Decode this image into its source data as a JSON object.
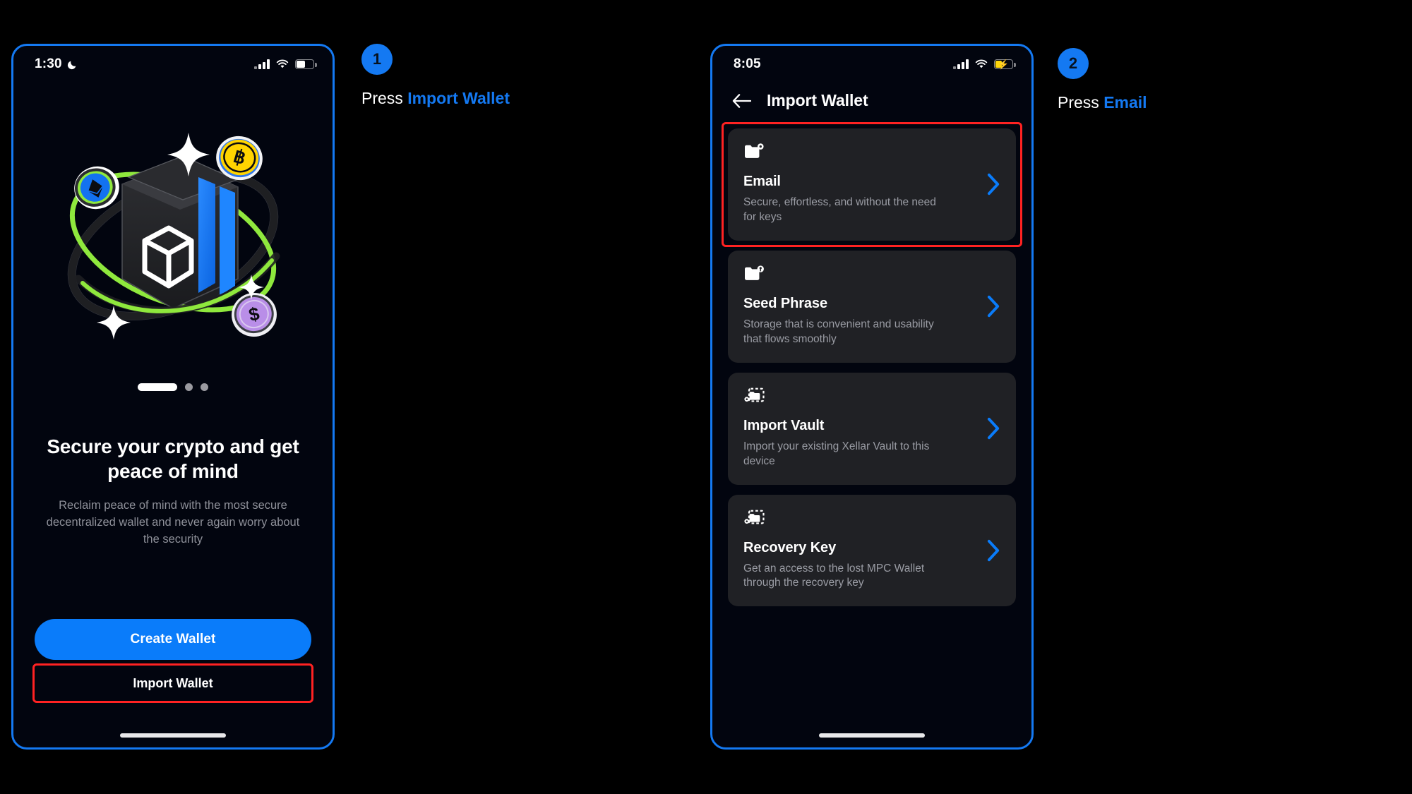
{
  "background_color": "#000000",
  "accent_blue": "#1479f2",
  "highlight_red": "#ff2222",
  "phones": [
    {
      "name": "onboarding",
      "status_bar": {
        "time": "1:30",
        "moon_icon": "moon-icon",
        "signal_icon": "cellular-bars-icon",
        "wifi_icon": "wifi-icon",
        "battery_icon": "battery-icon",
        "battery_level_pct": 45,
        "battery_charging": false
      },
      "illustration": {
        "name": "crypto-vault-illustration",
        "elements": [
          "vault-cube",
          "orbit-ring-green",
          "orbit-ring-dark",
          "coin-eth",
          "coin-btc",
          "coin-usd",
          "sparkle"
        ]
      },
      "pager": {
        "total": 3,
        "active_index": 0
      },
      "headline": "Secure your crypto and get peace of mind",
      "subhead": "Reclaim peace of mind with the most secure decentralized wallet and never again worry about the security",
      "primary_button": "Create Wallet",
      "secondary_button": "Import Wallet",
      "secondary_button_highlighted": true
    },
    {
      "name": "import-wallet",
      "status_bar": {
        "time": "8:05",
        "signal_icon": "cellular-bars-icon",
        "wifi_icon": "wifi-icon",
        "battery_icon": "battery-charging-icon",
        "battery_level_pct": 35,
        "battery_charging": true
      },
      "nav": {
        "back_icon": "arrow-left-icon",
        "title": "Import Wallet"
      },
      "options": [
        {
          "icon": "folder-gear-icon",
          "title": "Email",
          "desc": "Secure, effortless, and without the need for keys",
          "chevron": "chevron-right-icon",
          "highlighted": true
        },
        {
          "icon": "folder-lock-icon",
          "title": "Seed Phrase",
          "desc": "Storage that is convenient and usability that flows smoothly",
          "chevron": "chevron-right-icon",
          "highlighted": false
        },
        {
          "icon": "vault-import-icon",
          "title": "Import Vault",
          "desc": "Import your existing Xellar Vault to this device",
          "chevron": "chevron-right-icon",
          "highlighted": false
        },
        {
          "icon": "vault-import-icon",
          "title": "Recovery Key",
          "desc": "Get an access to the lost MPC Wallet through the recovery key",
          "chevron": "chevron-right-icon",
          "highlighted": false
        }
      ]
    }
  ],
  "annotations": [
    {
      "step": "1",
      "prefix": "Press ",
      "target": "Import Wallet"
    },
    {
      "step": "2",
      "prefix": "Press ",
      "target": "Email"
    }
  ]
}
